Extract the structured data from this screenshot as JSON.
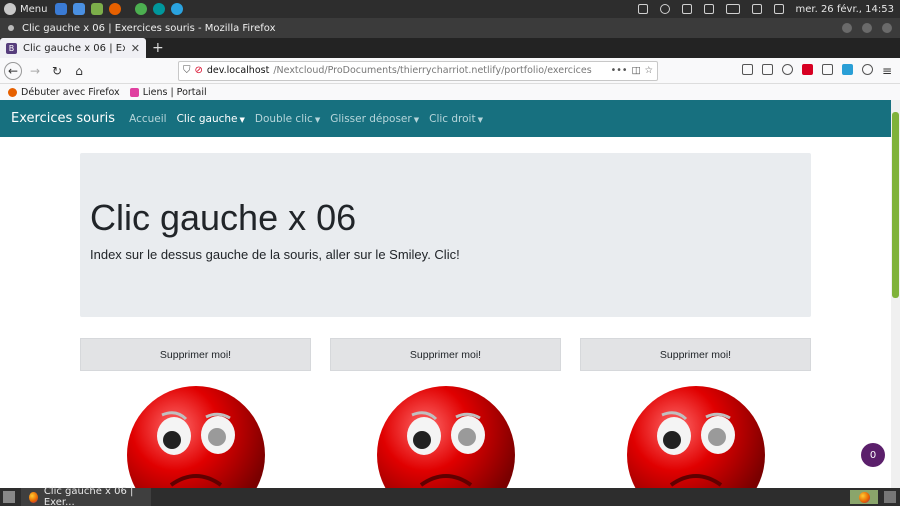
{
  "os": {
    "menu_label": "Menu",
    "clock": "mer. 26 févr., 14:53"
  },
  "window": {
    "title": "Clic gauche x 06 | Exercices souris - Mozilla Firefox"
  },
  "tab": {
    "title": "Clic gauche x 06 | Exercic",
    "new_tab": "+"
  },
  "urlbar": {
    "host": "dev.localhost",
    "path": "/Nextcloud/ProDocuments/thierrycharriot.netlify/portfolio/exercices",
    "more": "•••"
  },
  "bookmarks": {
    "items": [
      "Débuter avec Firefox",
      "Liens | Portail"
    ]
  },
  "site": {
    "brand": "Exercices souris",
    "nav": [
      "Accueil",
      "Clic gauche",
      "Double clic",
      "Glisser déposer",
      "Clic droit"
    ]
  },
  "jumbotron": {
    "title": "Clic gauche x 06",
    "lead": "Index sur le dessus gauche de la souris, aller sur le Smiley. Clic!"
  },
  "buttons": {
    "delete_label": "Supprimer moi!"
  },
  "badge": {
    "count": "0"
  },
  "taskbar": {
    "task_label": "Clic gauche x 06 | Exer..."
  },
  "colors": {
    "navbar": "#17707f",
    "jumbotron": "#e9ecef",
    "button": "#e2e3e5",
    "smiley": "#d40000",
    "badge": "#5b1f6b"
  }
}
